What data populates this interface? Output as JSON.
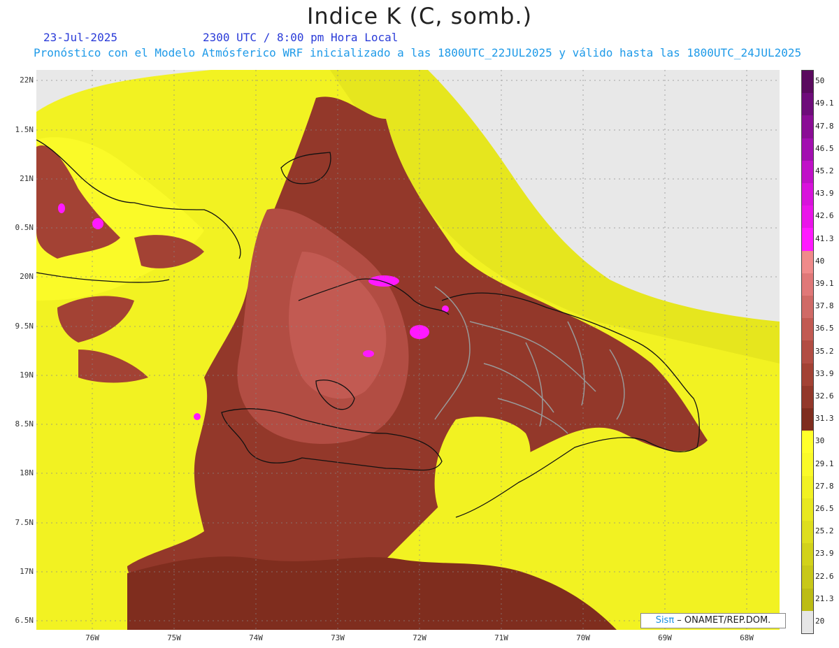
{
  "header": {
    "title": "Indice K (C, somb.)",
    "date": "23-Jul-2025",
    "time": "2300 UTC / 8:00 pm Hora Local",
    "description": "Pronóstico con el Modelo Atmósferico WRF inicializado a las 1800UTC_22JUL2025 y válido hasta las  1800UTC_24JUL2025"
  },
  "axes": {
    "lat_labels": [
      "22N",
      "1.5N",
      "21N",
      "0.5N",
      "20N",
      "9.5N",
      "19N",
      "8.5N",
      "18N",
      "7.5N",
      "17N",
      "6.5N"
    ],
    "lon_labels": [
      "76W",
      "75W",
      "74W",
      "73W",
      "72W",
      "71W",
      "70W",
      "69W",
      "68W"
    ]
  },
  "colorbar": {
    "labels": [
      "50",
      "49.1",
      "47.8",
      "46.5",
      "45.2",
      "43.9",
      "42.6",
      "41.3",
      "40",
      "39.1",
      "37.8",
      "36.5",
      "35.2",
      "33.9",
      "32.6",
      "31.3",
      "30",
      "29.1",
      "27.8",
      "26.5",
      "25.2",
      "23.9",
      "22.6",
      "21.3",
      "20"
    ],
    "colors": [
      "#5a0a5e",
      "#6e0c7a",
      "#8a0d95",
      "#a20fb0",
      "#c010c8",
      "#d812dc",
      "#ea14ea",
      "#ff19ff",
      "#f08a8a",
      "#e07878",
      "#d06a66",
      "#c25a52",
      "#b24d43",
      "#a34234",
      "#93382a",
      "#7f2d1e",
      "#ffff2a",
      "#fafa28",
      "#f2f222",
      "#e8e81f",
      "#dede1e",
      "#d2d21a",
      "#c8c818",
      "#bcbc14",
      "#e6e6e6"
    ]
  },
  "credit": {
    "brand": "Sisπ",
    "text": " – ONAMET/REP.DOM."
  }
}
